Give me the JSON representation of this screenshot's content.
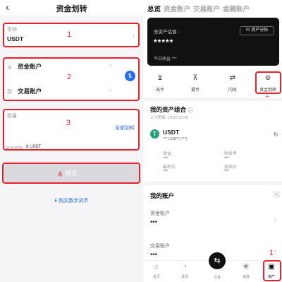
{
  "left": {
    "title": "资金划转",
    "back_icon": "chevron-left-icon",
    "currency": {
      "label": "币种",
      "value": "USDT"
    },
    "from": {
      "label": "从",
      "value": "资金账户"
    },
    "to": {
      "label": "到",
      "value": "交易账户"
    },
    "swap_icon": "swap-vertical-icon",
    "amount": {
      "label": "数量",
      "max_label": "全部划转"
    },
    "available": {
      "label": "最多可转",
      "value": "8 USDT"
    },
    "confirm": "确定",
    "buy_link": "购买数字货币",
    "annotations": [
      "1",
      "2",
      "3",
      "4"
    ]
  },
  "right": {
    "tabs": [
      "总览",
      "资金账户",
      "交易账户",
      "金融账户"
    ],
    "asset_card": {
      "label": "总资产估值",
      "value": "*****",
      "today_label": "今日收益",
      "today_value": "***",
      "analysis_button": "资产分析"
    },
    "actions": [
      {
        "label": "充币",
        "icon": "deposit-icon"
      },
      {
        "label": "提币",
        "icon": "withdraw-icon"
      },
      {
        "label": "闪兑",
        "icon": "flash-exchange-icon"
      },
      {
        "label": "资金划转",
        "icon": "transfer-icon"
      }
    ],
    "portfolio": {
      "title": "我的资产组合",
      "updated": "上次更新: 12/20 23:49",
      "coin": "USDT",
      "coin_sub": "*** USDT",
      "coin_sub_extra": "(***)",
      "stats": [
        {
          "label": "收益",
          "value": "***"
        },
        {
          "label": "收益率",
          "value": "***"
        },
        {
          "label": "最新价",
          "value": "***"
        },
        {
          "label": "成本价",
          "value": "***"
        }
      ]
    },
    "accounts": {
      "title": "我的账户",
      "items": [
        {
          "label": "资金账户",
          "value": "***"
        },
        {
          "label": "交易账户",
          "value": "***"
        }
      ]
    },
    "nav": [
      {
        "label": "首页",
        "icon": "home-icon"
      },
      {
        "label": "发现",
        "icon": "discover-icon"
      },
      {
        "label": "交易",
        "icon": "trade-icon"
      },
      {
        "label": "金融",
        "icon": "finance-icon"
      },
      {
        "label": "资产",
        "icon": "wallet-icon"
      }
    ],
    "annotations": [
      "2",
      "1"
    ]
  },
  "colors": {
    "annotation": "#e8202a",
    "accent": "#2a6de8"
  }
}
